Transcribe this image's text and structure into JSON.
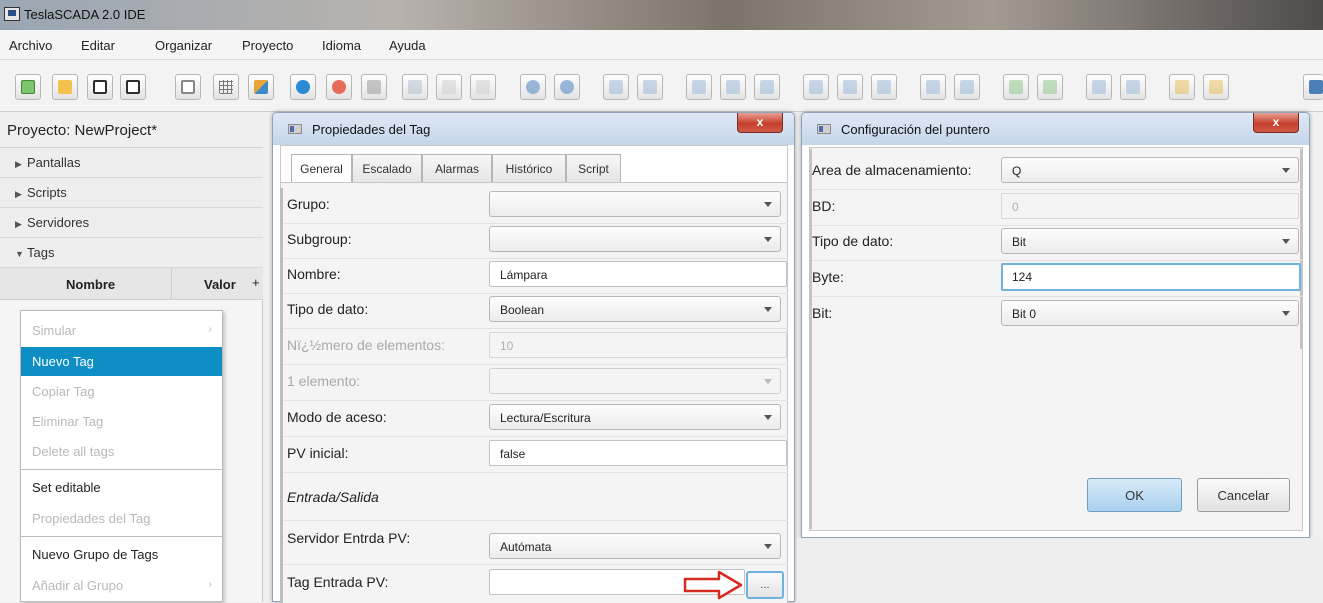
{
  "app": {
    "title": "TeslaSCADA 2.0 IDE"
  },
  "menu": [
    "Archivo",
    "Editar",
    "Organizar",
    "Proyecto",
    "Idioma",
    "Ayuda"
  ],
  "project": {
    "title": "Proyecto: NewProject*",
    "sections": [
      "Pantallas",
      "Scripts",
      "Servidores",
      "Tags"
    ],
    "tags_table": {
      "col_name": "Nombre",
      "col_value": "Valor",
      "add": "+"
    }
  },
  "context_menu": {
    "items": [
      {
        "label": "Simular",
        "state": "disabled",
        "submenu": true
      },
      {
        "label": "Nuevo Tag",
        "state": "selected"
      },
      {
        "label": "Copiar Tag",
        "state": "disabled"
      },
      {
        "label": "Eliminar Tag",
        "state": "disabled"
      },
      {
        "label": "Delete all tags",
        "state": "disabled"
      },
      {
        "label": "Set editable",
        "state": "enabled"
      },
      {
        "label": "Propiedades del Tag",
        "state": "disabled"
      },
      {
        "label": "Nuevo Grupo de Tags",
        "state": "enabled"
      },
      {
        "label": "Añadir al Grupo",
        "state": "disabled",
        "submenu": true
      }
    ],
    "submenu_glyph": "›"
  },
  "tag_props": {
    "title": "Propiedades del Tag",
    "close": "x",
    "tabs": [
      "General",
      "Escalado",
      "Alarmas",
      "Histórico",
      "Script"
    ],
    "fields": {
      "grupo": {
        "label": "Grupo:",
        "value": ""
      },
      "subgroup": {
        "label": "Subgroup:",
        "value": ""
      },
      "nombre": {
        "label": "Nombre:",
        "value": "Lámpara"
      },
      "tipo": {
        "label": "Tipo de dato:",
        "value": "Boolean"
      },
      "num_elem": {
        "label": "Nï¿½mero de elementos:",
        "value": "10"
      },
      "elem1": {
        "label": "1 elemento:",
        "value": ""
      },
      "modo": {
        "label": "Modo de aceso:",
        "value": "Lectura/Escritura"
      },
      "pv_inicial": {
        "label": "PV inicial:",
        "value": "false"
      },
      "section": "Entrada/Salida",
      "servidor": {
        "label": "Servidor Entrda PV:",
        "value": "Autómata"
      },
      "tag_entrada": {
        "label": "Tag Entrada PV:",
        "value": "",
        "browse": "..."
      }
    }
  },
  "pointer_config": {
    "title": "Configuración del puntero",
    "close": "x",
    "fields": {
      "area": {
        "label": "Area de almacenamiento:",
        "value": "Q"
      },
      "bd": {
        "label": "BD:",
        "value": "0"
      },
      "tipo": {
        "label": "Tipo de dato:",
        "value": "Bit"
      },
      "byte": {
        "label": "Byte:",
        "value": "124"
      },
      "bit": {
        "label": "Bit:",
        "value": "Bit 0"
      }
    },
    "ok": "OK",
    "cancel": "Cancelar"
  },
  "colors": {
    "selection": "#0d8fc6",
    "arrow": "#d42a1f",
    "focus": "#6fb2e0"
  }
}
